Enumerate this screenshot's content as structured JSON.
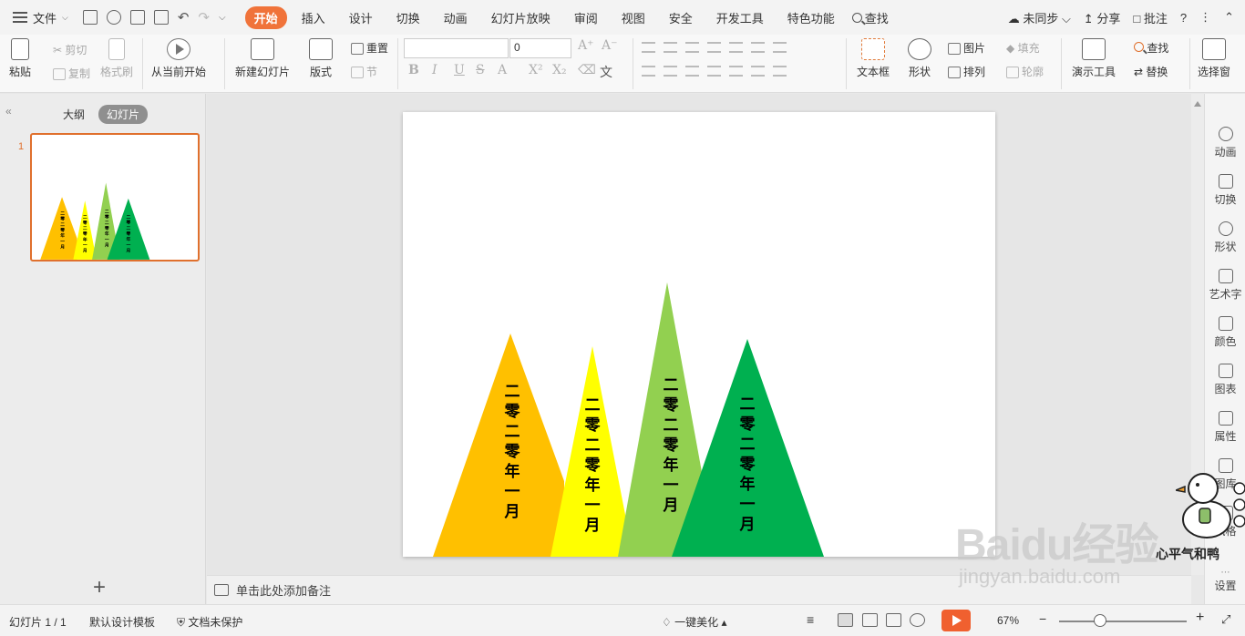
{
  "menubar": {
    "file_label": "文件",
    "tabs": [
      "开始",
      "插入",
      "设计",
      "切换",
      "动画",
      "幻灯片放映",
      "审阅",
      "视图",
      "安全",
      "开发工具",
      "特色功能"
    ],
    "search_label": "查找",
    "sync_label": "未同步",
    "share_label": "分享",
    "comment_label": "批注",
    "help_label": "?"
  },
  "ribbon": {
    "paste": "粘贴",
    "cut": "剪切",
    "copy": "复制",
    "format_painter": "格式刷",
    "from_current": "从当前开始",
    "new_slide": "新建幻灯片",
    "layout": "版式",
    "reset": "重置",
    "section": "节",
    "font_size_value": "0",
    "textbox": "文本框",
    "shape": "形状",
    "picture": "图片",
    "fill": "填充",
    "arrange": "排列",
    "outline": "轮廓",
    "present_tools": "演示工具",
    "find": "查找",
    "replace": "替换",
    "select_pane": "选择窗"
  },
  "left_panel": {
    "tab_outline": "大纲",
    "tab_slides": "幻灯片",
    "slide_number": "1",
    "add_label": "+"
  },
  "slide": {
    "triangles": [
      {
        "color": "#ffc000",
        "text": "二零二零年一月"
      },
      {
        "color": "#ffff00",
        "text": "二零二零年一月"
      },
      {
        "color": "#92d050",
        "text": "二零二零年一月"
      },
      {
        "color": "#00b050",
        "text": "二零二零年一月"
      }
    ]
  },
  "right_panel": {
    "items": [
      "动画",
      "切换",
      "形状",
      "艺术字",
      "颜色",
      "图表",
      "属性",
      "图库",
      "风格",
      "设置"
    ]
  },
  "notes": {
    "placeholder": "单击此处添加备注"
  },
  "status": {
    "slide_count": "幻灯片 1 / 1",
    "template": "默认设计模板",
    "protect": "文档未保护",
    "beautify": "一键美化",
    "zoom": "67%"
  },
  "watermark": {
    "brand": "Baidu经验",
    "url": "jingyan.baidu.com",
    "signature": "心平气和鸭"
  }
}
